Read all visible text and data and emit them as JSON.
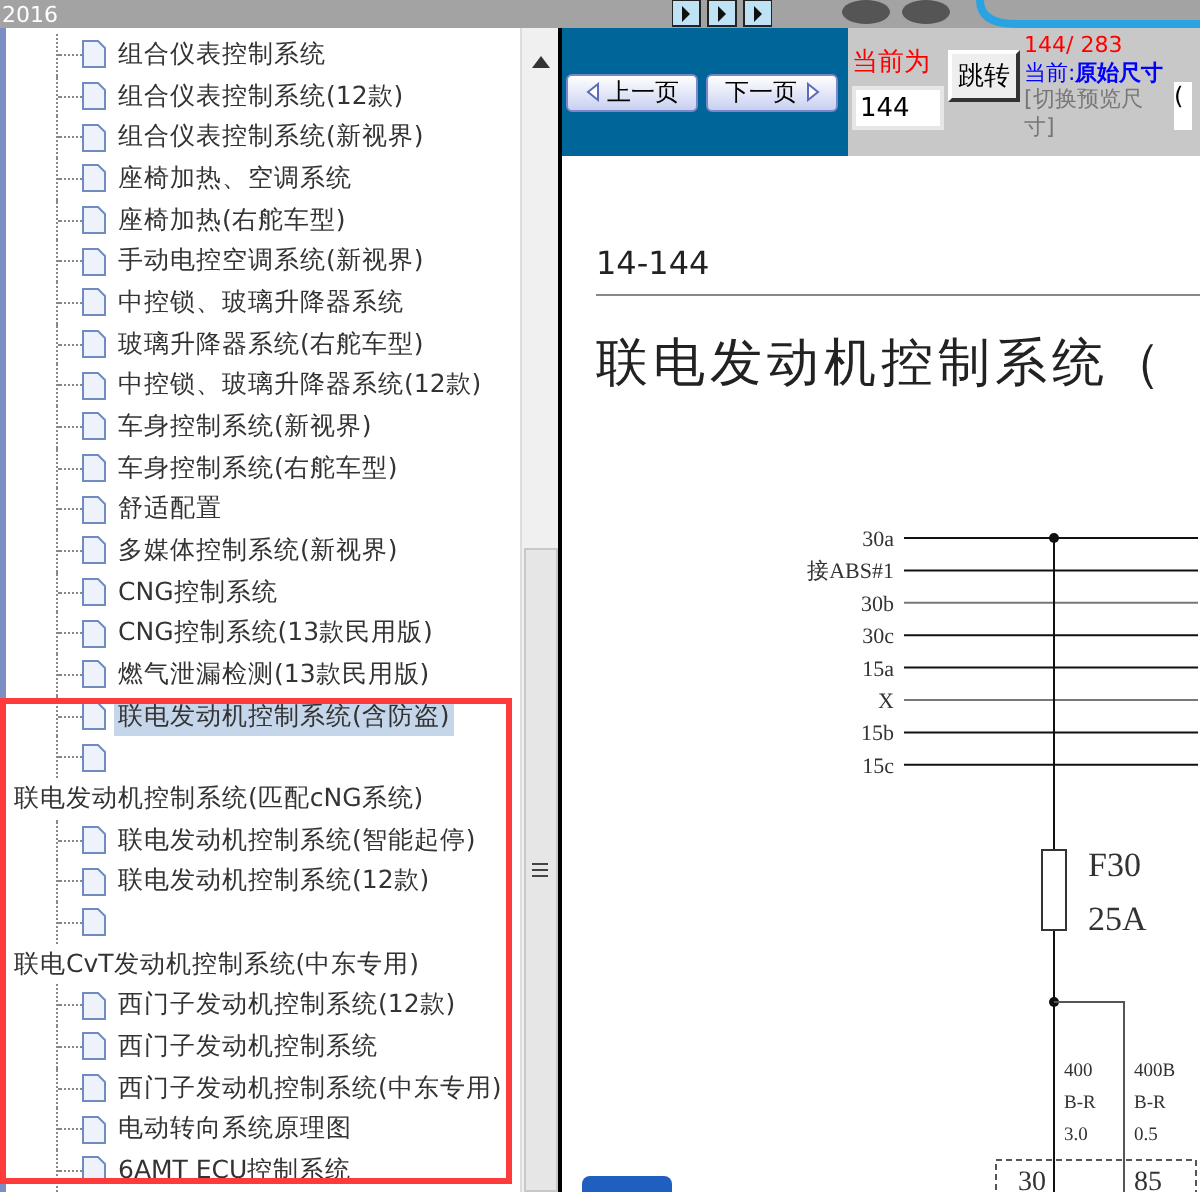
{
  "title_bar": {
    "title": "2016"
  },
  "tree": {
    "items": [
      {
        "kind": "leaf",
        "label": "组合仪表控制系统",
        "selected": false
      },
      {
        "kind": "leaf",
        "label": "组合仪表控制系统(12款)",
        "selected": false
      },
      {
        "kind": "leaf",
        "label": "组合仪表控制系统(新视界)",
        "selected": false
      },
      {
        "kind": "leaf",
        "label": "座椅加热、空调系统",
        "selected": false
      },
      {
        "kind": "leaf",
        "label": "座椅加热(右舵车型)",
        "selected": false
      },
      {
        "kind": "leaf",
        "label": "手动电控空调系统(新视界)",
        "selected": false
      },
      {
        "kind": "leaf",
        "label": "中控锁、玻璃升降器系统",
        "selected": false
      },
      {
        "kind": "leaf",
        "label": "玻璃升降器系统(右舵车型)",
        "selected": false
      },
      {
        "kind": "leaf",
        "label": "中控锁、玻璃升降器系统(12款)",
        "selected": false
      },
      {
        "kind": "leaf",
        "label": "车身控制系统(新视界)",
        "selected": false
      },
      {
        "kind": "leaf",
        "label": "车身控制系统(右舵车型)",
        "selected": false
      },
      {
        "kind": "leaf",
        "label": "舒适配置",
        "selected": false
      },
      {
        "kind": "leaf",
        "label": "多媒体控制系统(新视界)",
        "selected": false
      },
      {
        "kind": "leaf",
        "label": "CNG控制系统",
        "selected": false
      },
      {
        "kind": "leaf",
        "label": "CNG控制系统(13款民用版)",
        "selected": false
      },
      {
        "kind": "leaf",
        "label": "燃气泄漏检测(13款民用版)",
        "selected": false
      },
      {
        "kind": "leaf",
        "label": "联电发动机控制系统(含防盗)",
        "selected": true
      },
      {
        "kind": "leaf",
        "selected": false
      },
      {
        "kind": "group",
        "label": "联电发动机控制系统(匹配cNG系统)",
        "selected": false
      },
      {
        "kind": "leaf",
        "label": "联电发动机控制系统(智能起停)",
        "selected": false
      },
      {
        "kind": "leaf",
        "label": "联电发动机控制系统(12款)",
        "selected": false
      },
      {
        "kind": "leaf",
        "selected": false
      },
      {
        "kind": "group",
        "label": "联电CvT发动机控制系统(中东专用)",
        "selected": false
      },
      {
        "kind": "leaf",
        "label": "西门子发动机控制系统(12款)",
        "selected": false
      },
      {
        "kind": "leaf",
        "label": "西门子发动机控制系统",
        "selected": false
      },
      {
        "kind": "leaf",
        "label": "西门子发动机控制系统(中东专用)",
        "selected": false
      },
      {
        "kind": "leaf",
        "label": "电动转向系统原理图",
        "selected": false
      },
      {
        "kind": "leaf",
        "label": "6AMT ECU控制系统",
        "selected": false
      }
    ]
  },
  "pager": {
    "prev": "上一页",
    "next": "下一页",
    "current_label": "当前为",
    "page_input": "144",
    "go": "跳转",
    "page_count": "144/ 283",
    "size_label": "当前:",
    "size_value": "原始尺寸",
    "size_link": "[切换预览尺寸]",
    "cut_control": "("
  },
  "document": {
    "page_number": "14-144",
    "heading": "联电发动机控制系统（",
    "bus_labels": [
      "30a",
      "接ABS#1",
      "30b",
      "30c",
      "15a",
      "X",
      "15b",
      "15c"
    ],
    "fuse": [
      "F30",
      "25A"
    ],
    "wires": [
      [
        "400",
        "B-R",
        "3.0"
      ],
      [
        "400B",
        "B-R",
        "0.5"
      ]
    ],
    "terminals": [
      "30",
      "85"
    ]
  }
}
